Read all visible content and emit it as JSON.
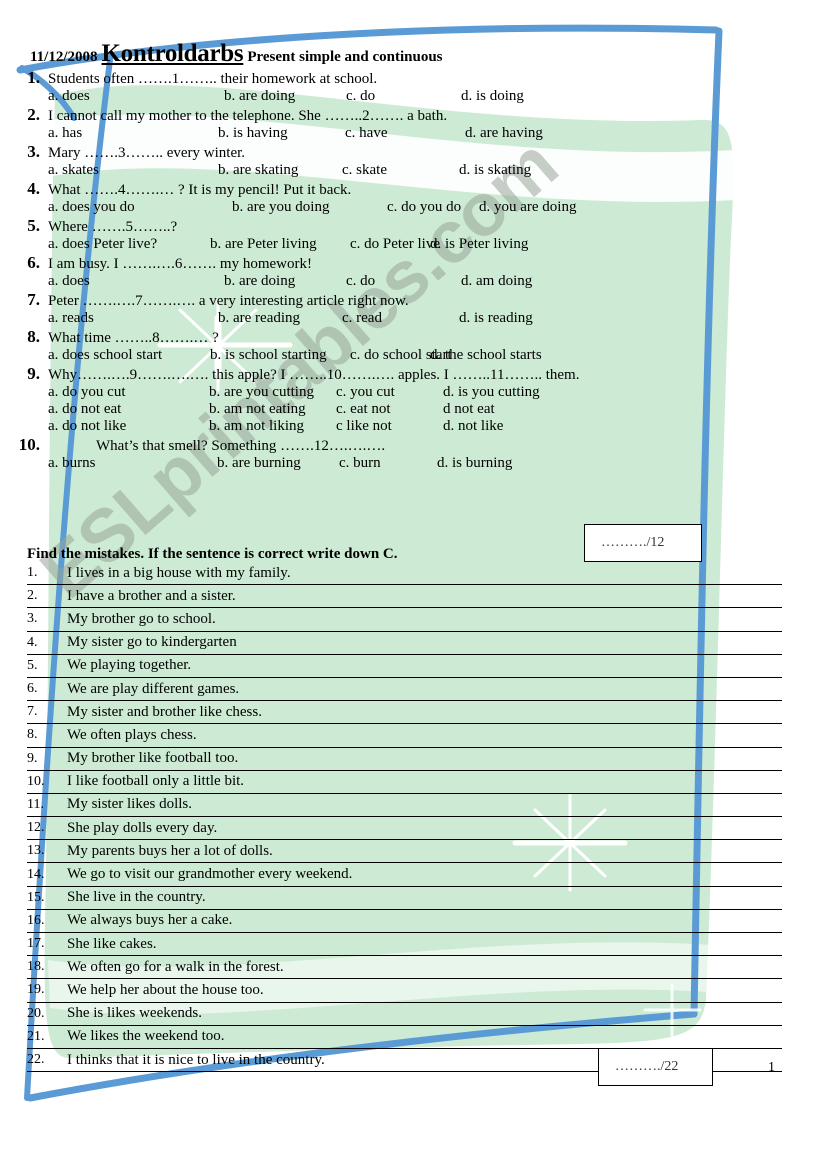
{
  "header": {
    "date": "11/12/2008",
    "title": "Kontroldarbs",
    "subtitle": "Present simple and continuous"
  },
  "colors": {
    "border_blue": "#5b9bd5",
    "background_green": "#cdebd4",
    "watermark_gray": "#9aa69a",
    "page_white": "#ffffff"
  },
  "watermark": "ESLprintables.com",
  "questions": [
    {
      "number": "1.",
      "text": "Students often …….1…….. their homework at school.",
      "rows": [
        [
          "a. does",
          "b. are doing",
          "c. do",
          "d. is doing"
        ]
      ]
    },
    {
      "number": "2.",
      "text": "I cannot call my mother to the telephone. She ……..2……. a bath.",
      "rows": [
        [
          "a. has",
          "b. is having",
          "c. have",
          "d. are having"
        ]
      ]
    },
    {
      "number": "3.",
      "text": "Mary …….3…….. every winter.",
      "rows": [
        [
          "a. skates",
          "b. are skating",
          "c. skate",
          "d. is skating"
        ]
      ]
    },
    {
      "number": "4.",
      "text": "What …….4…….… ? It is my pencil! Put it back.",
      "rows": [
        [
          "a. does you do",
          "b. are you doing",
          "c. do you do",
          "d. you are doing"
        ]
      ]
    },
    {
      "number": "5.",
      "text": "Where …….5……..?",
      "rows": [
        [
          "a. does Peter live?",
          "b. are Peter living",
          "c. do Peter live",
          "d. is Peter living"
        ]
      ]
    },
    {
      "number": "6.",
      "text": "I am busy. I …….….6……. my homework!",
      "rows": [
        [
          "a. does",
          "b. are doing",
          "c. do",
          "d. am doing"
        ]
      ]
    },
    {
      "number": "7.",
      "text": "Peter …….….7…….…. a very interesting article right now.",
      "rows": [
        [
          "a. reads",
          "b. are reading",
          "c. read",
          "d. is reading"
        ]
      ]
    },
    {
      "number": "8.",
      "text": "What time ……..8…….… ?",
      "rows": [
        [
          "a. does school start",
          "b. is school starting",
          "c. do school start",
          "d. the school starts"
        ]
      ]
    },
    {
      "number": "9.",
      "text": "Why…….….9…….….…. this apple? I ……..10…….…. apples. I ……..11…….. them.",
      "rows": [
        [
          "a. do you cut",
          "b. are you cutting",
          "c. you cut",
          "d. is you cutting"
        ],
        [
          "a. do not eat",
          "b. am not eating",
          "c. eat not",
          "d not eat"
        ],
        [
          "a. do not like",
          "b. am not liking",
          "c like not",
          "d. not like"
        ]
      ]
    },
    {
      "number": "10.",
      "text": "What’s that smell? Something …….12….….….",
      "rows": [
        [
          "a. burns",
          "b. are burning",
          "c. burn",
          "d. is burning"
        ]
      ]
    }
  ],
  "score_box_1": "………./12",
  "score_box_2": "………./22",
  "section2": {
    "title": "Find the mistakes. If the sentence is correct write down  C.",
    "items": [
      {
        "number": "1.",
        "text": "I lives in a big house with my family."
      },
      {
        "number": "2.",
        "text": "I have a brother and a sister."
      },
      {
        "number": "3.",
        "text": "My brother go to school."
      },
      {
        "number": "4.",
        "text": "My sister go to kindergarten"
      },
      {
        "number": "5.",
        "text": "We playing together."
      },
      {
        "number": "6.",
        "text": "We are play different games."
      },
      {
        "number": "7.",
        "text": "My sister and brother like chess."
      },
      {
        "number": "8.",
        "text": "We often plays chess."
      },
      {
        "number": "9.",
        "text": "My brother like football too."
      },
      {
        "number": "10.",
        "text": "I like football only a little bit."
      },
      {
        "number": "11.",
        "text": "My sister likes dolls."
      },
      {
        "number": "12.",
        "text": "She play dolls every day."
      },
      {
        "number": "13.",
        "text": "My parents buys her a lot of dolls."
      },
      {
        "number": "14.",
        "text": "We go to visit our grandmother every weekend."
      },
      {
        "number": "15.",
        "text": "She live in the country."
      },
      {
        "number": "16.",
        "text": "We always buys her a cake."
      },
      {
        "number": "17.",
        "text": "She like cakes."
      },
      {
        "number": "18.",
        "text": "We often go for a walk in the forest."
      },
      {
        "number": "19.",
        "text": "We help her about the house too."
      },
      {
        "number": "20.",
        "text": "She is likes weekends."
      },
      {
        "number": "21.",
        "text": "We likes the weekend too."
      },
      {
        "number": "22.",
        "text": "I thinks that it is nice to live in the country."
      }
    ]
  },
  "page_number": "1"
}
